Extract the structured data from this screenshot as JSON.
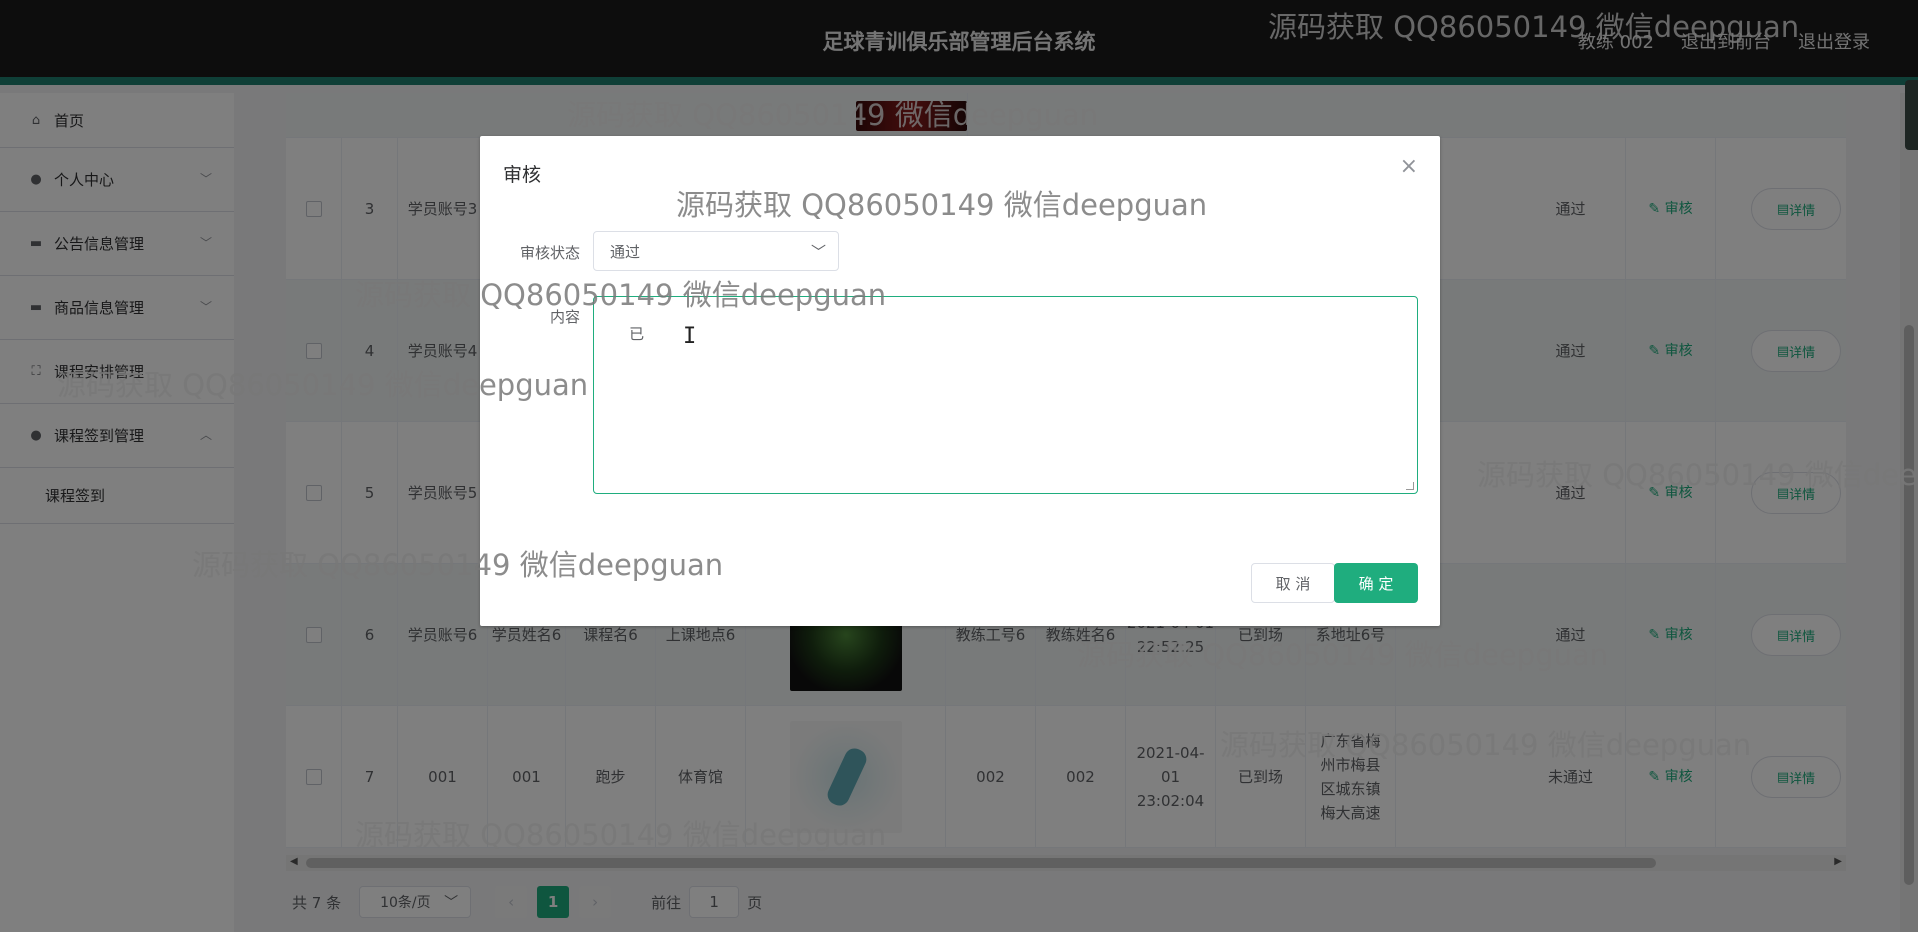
{
  "header": {
    "title": "足球青训俱乐部管理后台系统",
    "user": "教练 002",
    "to_front": "退出到前台",
    "logout": "退出登录"
  },
  "sidebar": {
    "items": [
      {
        "label": "首页",
        "icon": "home-icon"
      },
      {
        "label": "个人中心",
        "icon": "user-icon"
      },
      {
        "label": "公告信息管理",
        "icon": "notice-icon"
      },
      {
        "label": "商品信息管理",
        "icon": "goods-icon"
      },
      {
        "label": "课程安排管理",
        "icon": "schedule-icon"
      },
      {
        "label": "课程签到管理",
        "icon": "user-icon"
      }
    ],
    "sub_item": "课程签到"
  },
  "table": {
    "rows": [
      {
        "index": "3",
        "student_account": "学员账号3",
        "status": "通过",
        "audit": "审核",
        "detail": "详情"
      },
      {
        "index": "4",
        "student_account": "学员账号4",
        "status": "通过",
        "audit": "审核",
        "detail": "详情"
      },
      {
        "index": "5",
        "student_account": "学员账号5",
        "status": "通过",
        "audit": "审核",
        "detail": "详情"
      },
      {
        "index": "6",
        "student_account": "学员账号6",
        "student_name": "学员姓名6",
        "course": "课程名6",
        "location": "上课地点6",
        "coach_account": "教练工号6",
        "coach_name": "教练姓名6",
        "time": "2021-04-01 22:52:25",
        "sign_status": "已到场",
        "address": "系地址6号",
        "status": "通过",
        "audit": "审核",
        "detail": "详情"
      },
      {
        "index": "7",
        "student_account": "001",
        "student_name": "001",
        "course": "跑步",
        "location": "体育馆",
        "coach_account": "002",
        "coach_name": "002",
        "time": "2021-04-01 23:02:04",
        "sign_status": "已到场",
        "address": "广东省梅州市梅县区城东镇梅大高速",
        "status": "未通过",
        "audit": "审核",
        "detail": "详情"
      }
    ]
  },
  "pagination": {
    "total": "共 7 条",
    "page_size": "10条/页",
    "current_page": "1",
    "goto_label": "前往",
    "goto_value": "1",
    "page_suffix": "页"
  },
  "dialog": {
    "title": "审核",
    "status_label": "审核状态",
    "status_value": "通过",
    "content_label": "内容",
    "content_value": "已",
    "cancel": "取 消",
    "confirm": "确 定"
  },
  "watermark": "源码获取 QQ86050149 微信deepguan",
  "watermark_clipped": "源码获取 QQ86050149 微信dee",
  "colors": {
    "accent": "#1fad7e",
    "header_bg": "#1b1b1b",
    "header_strip": "#1f7f6f"
  }
}
